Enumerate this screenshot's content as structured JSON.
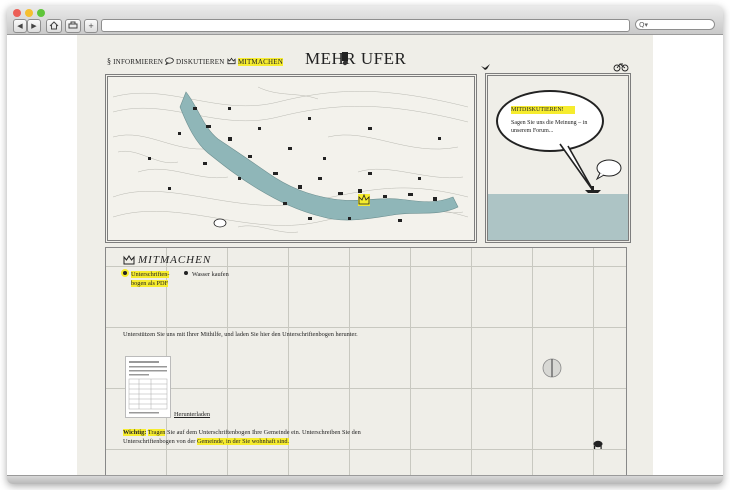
{
  "browser": {
    "back_label": "◀",
    "forward_label": "▶",
    "home_icon": "home-icon",
    "print_icon": "print-icon",
    "add_label": "+",
    "search_placeholder": "Q▾"
  },
  "nav": {
    "informieren": "INFORMIEREN",
    "diskutieren": "DISKUTIEREN",
    "mitmachen": "MITMACHEN"
  },
  "logo": "MEHR UFER",
  "forum": {
    "title": "MITDISKUTIEREN!",
    "text": "Sagen Sie uns die Meinung – in unserem Forum..."
  },
  "mitmachen": {
    "heading": "MITMACHEN",
    "option1": "Unterschriften-bogen als PDF",
    "option1_line1": "Unterschriften-",
    "option1_line2": "bogen als PDF",
    "option2": "Wasser kaufen",
    "intro": "Unterstützen Sie uns mit Ihrer Mithilfe, und laden Sie hier den Unterschriftenbogen herunter.",
    "download": "Herunterladen",
    "note_label": "Wichtig:",
    "note_part1": "Tragen",
    "note_part2": " Sie auf dem Unterschriftenbogen Ihre Gemeinde ein. Unterschreiben Sie den Unterschriftenbogen von der ",
    "note_part3": "Gemeinde, in der Sie wohnhaft sind."
  },
  "colors": {
    "highlight": "#f6ec2e",
    "lake": "#8fb6b8",
    "forum_water": "#adc4c5",
    "paper": "#efeee8"
  }
}
